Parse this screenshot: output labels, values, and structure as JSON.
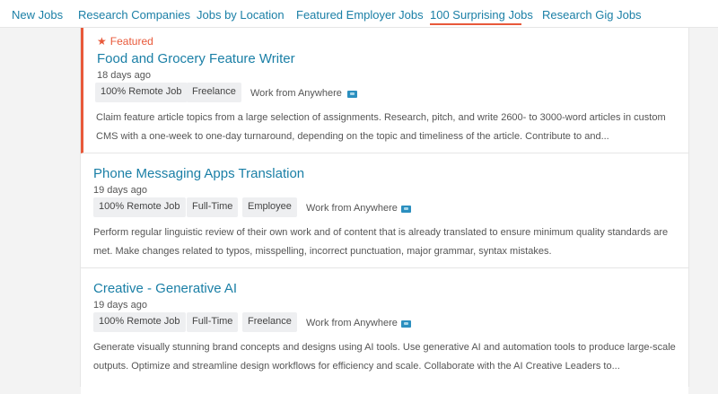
{
  "nav": {
    "items": [
      {
        "label": "New Jobs"
      },
      {
        "label": "Research Companies"
      },
      {
        "label": "Jobs by Location"
      },
      {
        "label": "Featured Employer Jobs"
      },
      {
        "label": "100 Surprising Jobs"
      },
      {
        "label": "Research Gig Jobs"
      }
    ],
    "active": "100 Surprising Jobs",
    "accent_color": "#e8593a",
    "link_color": "#1a7fa6"
  },
  "jobs": [
    {
      "featured_label": "Featured",
      "title": "Food and Grocery Feature Writer",
      "age": "18 days ago",
      "tags": [
        "100% Remote Job",
        "Freelance"
      ],
      "location": "Work from Anywhere",
      "location_icon": "map-icon",
      "description": "Claim feature article topics from a large selection of assignments. Research, pitch, and write 2600- to 3000-word articles in custom CMS with a one-week to one-day turnaround, depending on the topic and timeliness of the article. Contribute to and..."
    },
    {
      "title": "Phone Messaging Apps Translation",
      "age": "19 days ago",
      "tags": [
        "100% Remote Job",
        "Full-Time",
        "Employee"
      ],
      "location": "Work from Anywhere",
      "location_icon": "map-icon",
      "description": "Perform regular linguistic review of their own work and of content that is already translated to ensure minimum quality standards are met. Make changes related to typos, misspelling, incorrect punctuation, major grammar, syntax mistakes."
    },
    {
      "title": "Creative - Generative AI",
      "age": "19 days ago",
      "tags": [
        "100% Remote Job",
        "Full-Time",
        "Freelance"
      ],
      "location": "Work from Anywhere",
      "location_icon": "map-icon",
      "description": "Generate visually stunning brand concepts and designs using AI tools. Use generative AI and automation tools to produce large-scale outputs. Optimize and streamline design workflows for efficiency and scale. Collaborate with the AI Creative Leaders to..."
    }
  ]
}
